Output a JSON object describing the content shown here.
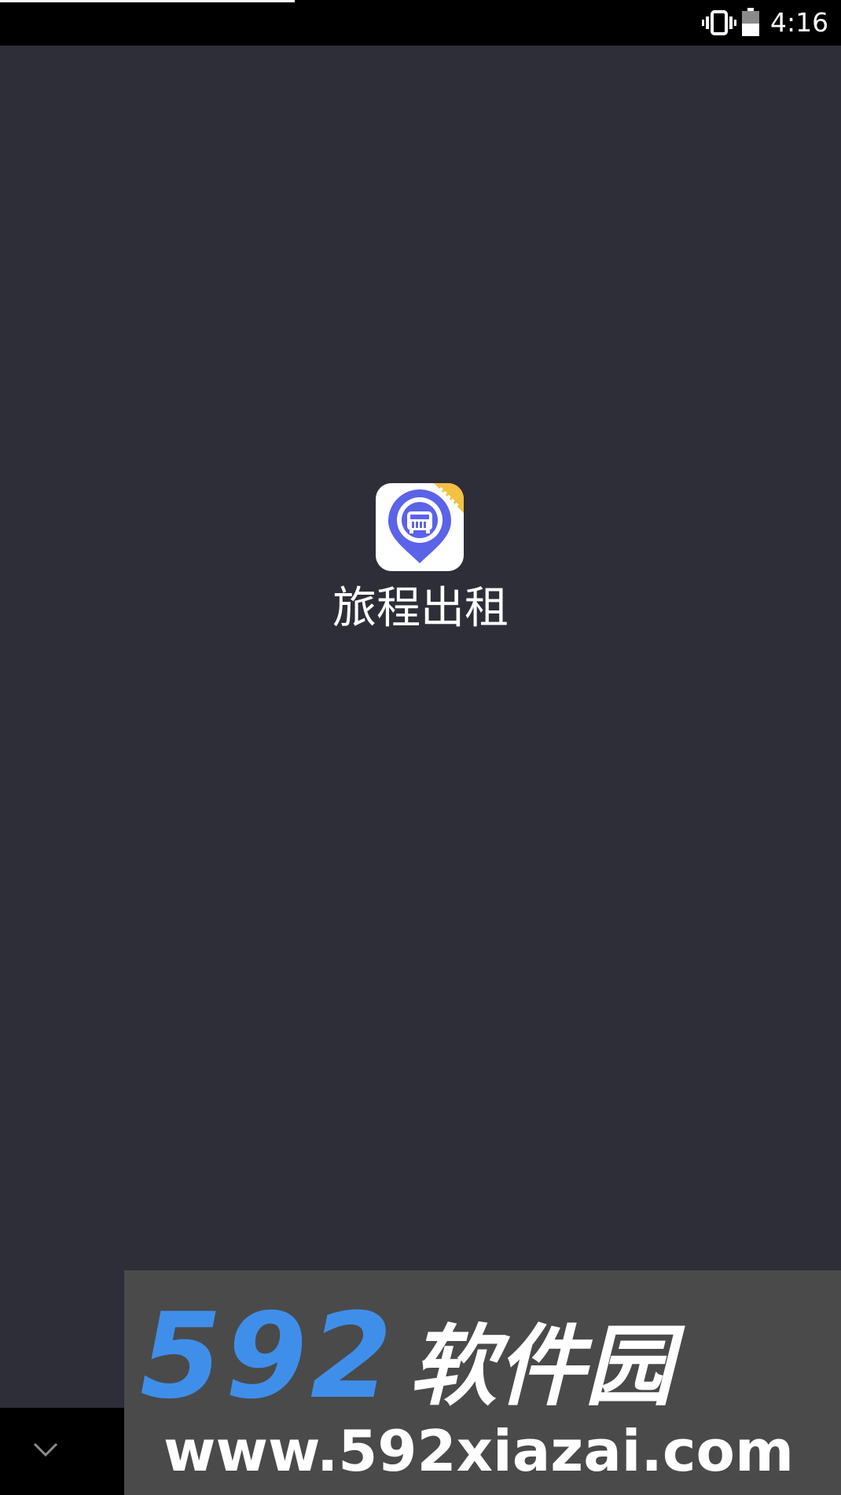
{
  "status_bar": {
    "time": "4:16",
    "icons": [
      "vibrate-icon",
      "battery-icon"
    ]
  },
  "splash": {
    "app_name": "旅程出租",
    "app_icon": "taxi-location-pin-icon",
    "background_color": "#2e2e39",
    "icon_accent_color": "#5b63e8",
    "badge_color": "#f5c143"
  },
  "navigation": {
    "collapse_icon": "chevron-down-icon"
  },
  "watermark": {
    "number": "592",
    "name": "软件园",
    "url": "www.592xiazai.com"
  }
}
